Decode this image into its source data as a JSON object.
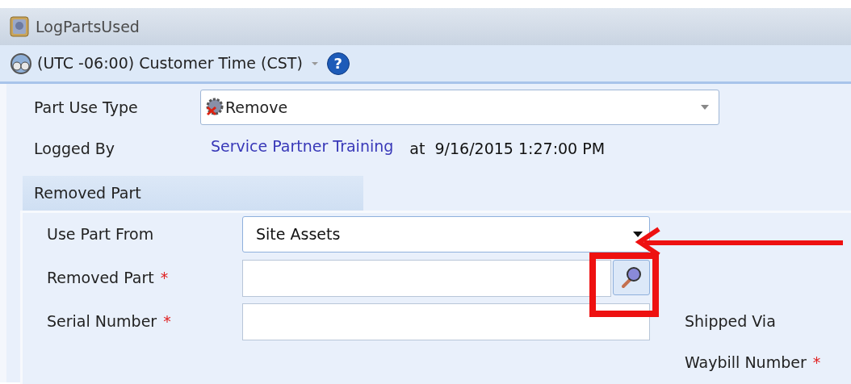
{
  "window": {
    "title": "LogPartsUsed"
  },
  "toolbar": {
    "timezone": "(UTC -06:00) Customer Time (CST)",
    "help": "?"
  },
  "form": {
    "part_use_type": {
      "label": "Part Use Type",
      "value": "Remove"
    },
    "logged_by": {
      "label": "Logged By",
      "user": "Service Partner Training",
      "at": "at  9/16/2015 1:27:00 PM"
    }
  },
  "section": {
    "tab": "Removed Part",
    "fields": [
      {
        "kind": "select",
        "label": "Use Part From",
        "value": "Site Assets"
      },
      {
        "kind": "lookup",
        "label": "Removed Part",
        "required_mark": "*"
      },
      {
        "kind": "text",
        "label": "Serial Number",
        "required_mark": "*"
      }
    ],
    "side_fields": [
      {
        "label": "Shipped Via"
      },
      {
        "label": "Waybill Number",
        "required_mark": "*"
      }
    ]
  }
}
